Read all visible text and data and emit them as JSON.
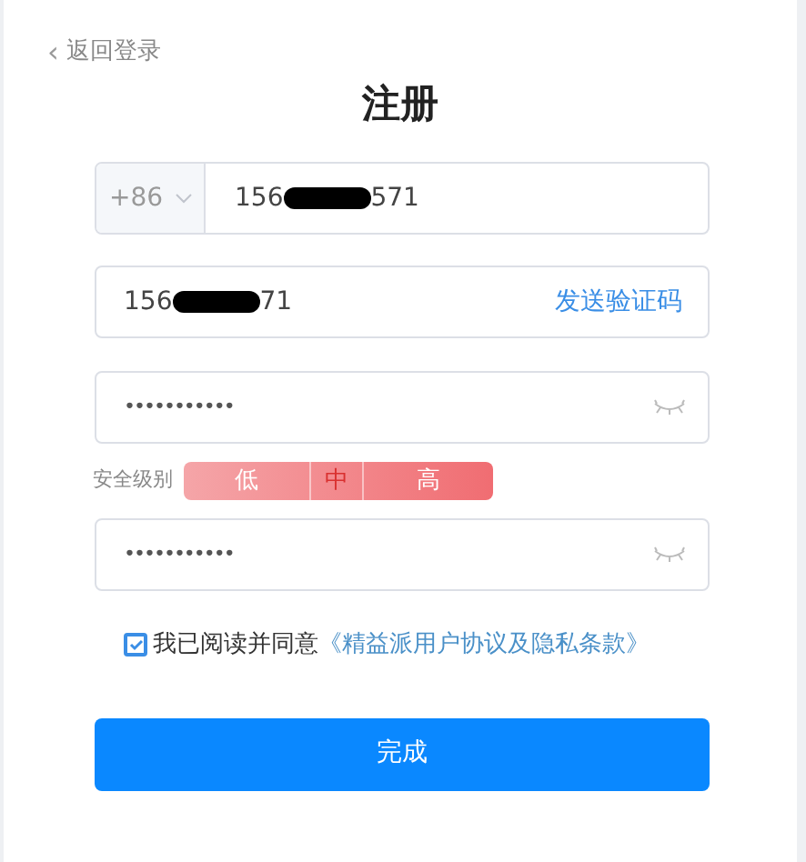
{
  "back_link": {
    "icon": "‹",
    "label": "返回登录"
  },
  "title": "注册",
  "phone": {
    "country_code": "+86",
    "value_start": "156",
    "value_end": "571",
    "redacted": true
  },
  "code": {
    "value_start": "156",
    "value_end": "71",
    "redacted": true,
    "send_button": "发送验证码"
  },
  "password": {
    "value": "•••••••••••",
    "visible": false
  },
  "strength": {
    "label": "安全级别",
    "levels": [
      {
        "label": "低",
        "selected": false
      },
      {
        "label": "中",
        "selected": true
      },
      {
        "label": "高",
        "selected": false
      }
    ]
  },
  "confirm_password": {
    "value": "•••••••••••",
    "visible": false
  },
  "agreement": {
    "checked": true,
    "text": "我已阅读并同意",
    "link": "《精益派用户协议及隐私条款》"
  },
  "submit_button": "完成"
}
